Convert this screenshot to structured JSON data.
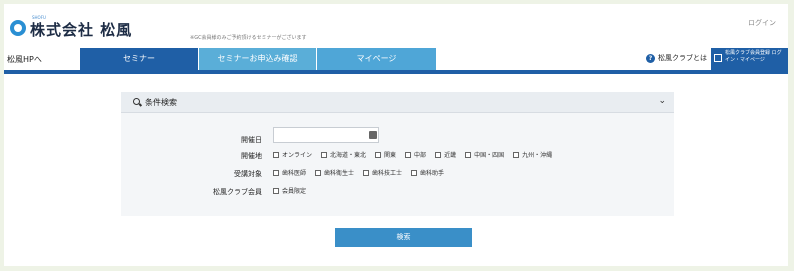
{
  "header": {
    "company_name": "株式会社 松風",
    "company_sub": "SHOFU",
    "notice": "※GC会員様のみご予約頂けるセミナーがございます",
    "user_link": "ログイン"
  },
  "nav": {
    "back": "松風HPへ",
    "tabs": [
      {
        "label": "セミナー",
        "active": true
      },
      {
        "label": "セミナーお申込み確認",
        "active": false
      },
      {
        "label": "マイページ",
        "active": false
      }
    ],
    "help_label": "松風クラブとは",
    "online_button": "松風クラブ会員登録 ログイン・マイページ"
  },
  "search": {
    "title": "条件検索",
    "fields": [
      {
        "label": "開催日",
        "type": "date",
        "value": "",
        "icon": "calendar-icon"
      },
      {
        "label": "開催地",
        "type": "checkbox",
        "options": [
          "オンライン",
          "北海道・東北",
          "関東",
          "中部",
          "近畿",
          "中国・四国",
          "九州・沖縄"
        ]
      },
      {
        "label": "受講対象",
        "type": "checkbox",
        "options": [
          "歯科医師",
          "歯科衛生士",
          "歯科技工士",
          "歯科助手"
        ]
      },
      {
        "label": "松風クラブ会員",
        "type": "checkbox",
        "options": [
          "会員限定"
        ]
      }
    ],
    "submit_label": "検索"
  },
  "colors": {
    "brand_blue": "#1f5fa6",
    "tab_light": "#5aaed8",
    "submit": "#3a8fc8"
  }
}
